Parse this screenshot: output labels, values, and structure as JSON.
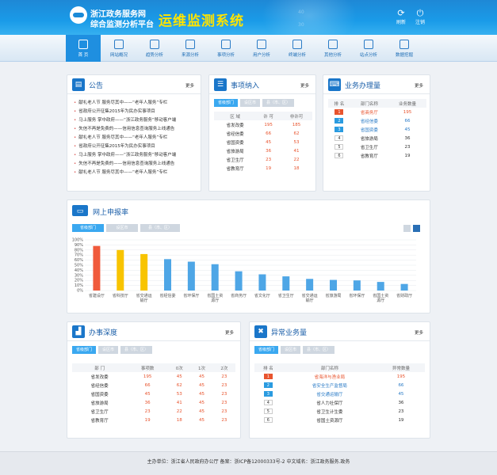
{
  "header": {
    "title1": "浙江政务服务网",
    "title2": "综合监测分析平台",
    "title3": "运维监测系统",
    "refresh": "刷新",
    "logout": "注销",
    "bg_num1": "40",
    "bg_num2": "30"
  },
  "nav": [
    {
      "label": "首 页",
      "icon": "home-icon"
    },
    {
      "label": "网站概况",
      "icon": "site-icon"
    },
    {
      "label": "趋势分析",
      "icon": "trend-icon"
    },
    {
      "label": "来源分析",
      "icon": "source-icon"
    },
    {
      "label": "事项分析",
      "icon": "item-icon"
    },
    {
      "label": "用户分析",
      "icon": "user-icon"
    },
    {
      "label": "终端分析",
      "icon": "terminal-icon"
    },
    {
      "label": "其他分析",
      "icon": "other-icon"
    },
    {
      "label": "站点分析",
      "icon": "station-icon"
    },
    {
      "label": "数据挖掘",
      "icon": "mining-icon"
    }
  ],
  "notice": {
    "title": "公告",
    "more": "更多",
    "items": [
      "献礼老人节 服务尽其中——“老年人服务”专栏",
      "省政府公开征集2015年为民办实事项目",
      "马上服务 掌中政府——“浙江政务服务”移动客户端",
      "失信不再是免费的——信用信息查询服务上线通告",
      "献礼老人节 服务尽其中——“老年人服务”专栏",
      "省政府公开征集2015年为民办实事项目",
      "马上服务 掌中政府——“浙江政务服务”移动客户端",
      "失信不再是免费的——信用信息查询服务上线通告",
      "献礼老人节 服务尽其中——“老年人服务”专栏"
    ]
  },
  "tabs": [
    "省级部门",
    "设区市",
    "县（市、区）"
  ],
  "accept": {
    "title": "事项纳入",
    "more": "更多",
    "cols": [
      "区 域",
      "许 可",
      "非许可"
    ],
    "rows": [
      [
        "省发改委",
        "195",
        "185"
      ],
      [
        "省经信委",
        "66",
        "62"
      ],
      [
        "省国资委",
        "45",
        "53"
      ],
      [
        "省旅游局",
        "36",
        "41"
      ],
      [
        "省卫生厅",
        "23",
        "22"
      ],
      [
        "省教育厅",
        "19",
        "18"
      ]
    ]
  },
  "handle": {
    "title": "业务办理量",
    "more": "更多",
    "cols": [
      "排 名",
      "部门名称",
      "业务数量"
    ],
    "rows": [
      [
        "1",
        "省商务厅",
        "195"
      ],
      [
        "2",
        "省经信委",
        "66"
      ],
      [
        "3",
        "省国资委",
        "45"
      ],
      [
        "4",
        "省旅游局",
        "36"
      ],
      [
        "5",
        "省卫生厅",
        "23"
      ],
      [
        "6",
        "省教育厅",
        "19"
      ]
    ]
  },
  "online": {
    "title": "网上申报率"
  },
  "chart_data": {
    "type": "bar",
    "categories": [
      "省建设厅",
      "省科技厅",
      "省交通运输厅",
      "省经信委",
      "省环保厅",
      "省国土资源厅",
      "省商务厅",
      "省文化厅",
      "省卫生厅",
      "省交通运输厅",
      "省旅游局",
      "省环保厅",
      "省国土资源厅",
      "省财政厅"
    ],
    "values": [
      88,
      80,
      72,
      62,
      57,
      52,
      38,
      32,
      28,
      23,
      21,
      20,
      17,
      13
    ],
    "colors": [
      "#f05a3c",
      "#f8c400",
      "#f8c400",
      "#4ea6e6",
      "#4ea6e6",
      "#4ea6e6",
      "#4ea6e6",
      "#4ea6e6",
      "#4ea6e6",
      "#4ea6e6",
      "#4ea6e6",
      "#4ea6e6",
      "#4ea6e6",
      "#4ea6e6"
    ],
    "yticks": [
      "100%",
      "90%",
      "80%",
      "70%",
      "60%",
      "50%",
      "40%",
      "30%",
      "20%",
      "10%",
      "0%"
    ],
    "ylim": [
      0,
      100
    ]
  },
  "depth": {
    "title": "办事深度",
    "more": "更多",
    "cols": [
      "部 门",
      "事项数",
      "0次",
      "1次",
      "2次"
    ],
    "rows": [
      [
        "省发改委",
        "195",
        "45",
        "45",
        "23"
      ],
      [
        "省经信委",
        "66",
        "62",
        "45",
        "23"
      ],
      [
        "省国资委",
        "45",
        "53",
        "45",
        "23"
      ],
      [
        "省旅游局",
        "36",
        "41",
        "45",
        "23"
      ],
      [
        "省卫生厅",
        "23",
        "22",
        "45",
        "23"
      ],
      [
        "省教育厅",
        "19",
        "18",
        "45",
        "23"
      ]
    ]
  },
  "abnormal": {
    "title": "异常业务量",
    "more": "更多",
    "cols": [
      "排 名",
      "部门名称",
      "异常数量"
    ],
    "rows": [
      [
        "1",
        "省海洋与渔业局",
        "195"
      ],
      [
        "2",
        "省安全生产监督局",
        "66"
      ],
      [
        "3",
        "省交通运输厅",
        "45"
      ],
      [
        "4",
        "省人力社保厅",
        "36"
      ],
      [
        "5",
        "省卫生计生委",
        "23"
      ],
      [
        "6",
        "省国土资源厅",
        "19"
      ]
    ]
  },
  "footer": {
    "text": "主办单位：浙江省人民政府办公厅    备案：浙ICP备12000333号-2    中文域名：浙江政务服务.政务"
  }
}
